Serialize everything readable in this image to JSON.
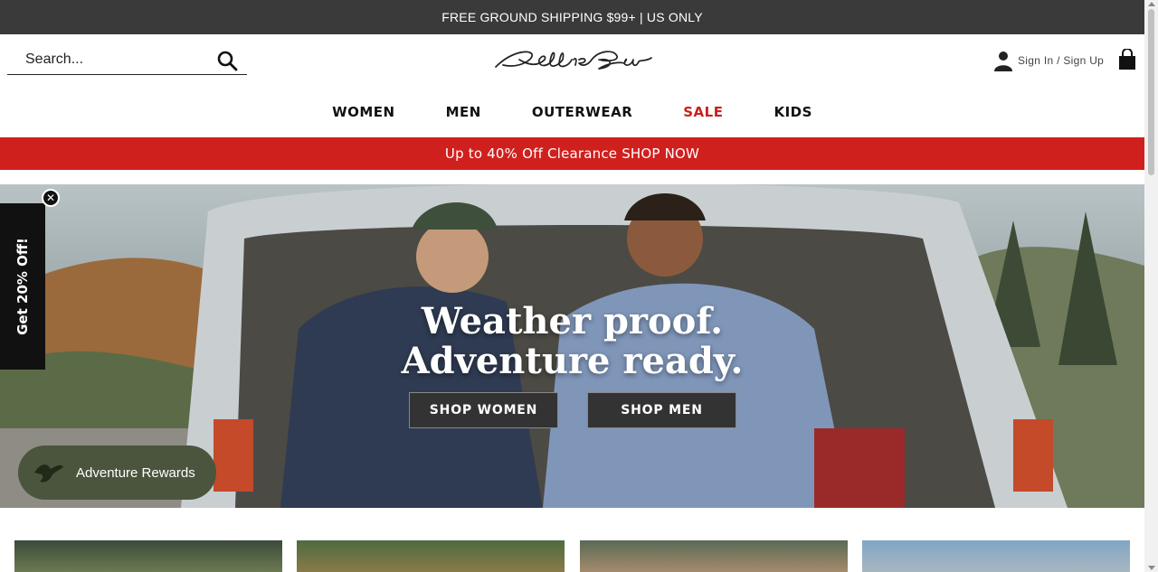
{
  "topbar": {
    "text": "FREE GROUND SHIPPING $99+ | US ONLY"
  },
  "header": {
    "search_placeholder": "Search...",
    "logo_alt": "Eddie Bauer",
    "account_label": "Sign In / Sign Up"
  },
  "nav": {
    "items": [
      {
        "label": "WOMEN"
      },
      {
        "label": "MEN"
      },
      {
        "label": "OUTERWEAR"
      },
      {
        "label": "SALE"
      },
      {
        "label": "KIDS"
      }
    ]
  },
  "promo": {
    "text": "Up to 40% Off Clearance SHOP NOW"
  },
  "hero": {
    "headline_line1": "Weather proof.",
    "headline_line2": "Adventure ready.",
    "button_women": "SHOP WOMEN",
    "button_men": "SHOP MEN"
  },
  "side_tab": {
    "label": "Get 20% Off!"
  },
  "rewards": {
    "label": "Adventure Rewards"
  },
  "colors": {
    "sale": "#c8201f",
    "promo_bg": "#d0201e",
    "topbar_bg": "#3a3a3a",
    "rewards_bg": "#4b553d"
  }
}
